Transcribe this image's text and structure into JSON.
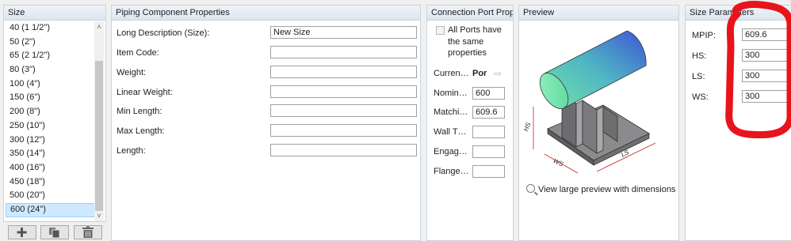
{
  "size_panel": {
    "title": "Size",
    "items": [
      "40 (1 1/2\")",
      "50 (2\")",
      "65 (2 1/2\")",
      "80 (3\")",
      "100 (4\")",
      "150 (6\")",
      "200 (8\")",
      "250 (10\")",
      "300 (12\")",
      "350 (14\")",
      "400 (16\")",
      "450 (18\")",
      "500 (20\")",
      "600 (24\")"
    ],
    "selected_index": 13,
    "buttons": [
      "add-icon",
      "copy-icon",
      "delete-icon"
    ]
  },
  "props_panel": {
    "title": "Piping Component Properties",
    "fields": [
      {
        "label": "Long Description (Size):",
        "value": "New Size"
      },
      {
        "label": "Item Code:",
        "value": ""
      },
      {
        "label": "Weight:",
        "value": ""
      },
      {
        "label": "Linear Weight:",
        "value": ""
      },
      {
        "label": "Min Length:",
        "value": ""
      },
      {
        "label": "Max Length:",
        "value": ""
      },
      {
        "label": "Length:",
        "value": ""
      }
    ]
  },
  "conn_panel": {
    "title": "Connection Port Prop",
    "checkbox_label": "All Ports have the same properties",
    "checkbox_checked": false,
    "current_label": "Curren…",
    "current_value": "Por",
    "fields": [
      {
        "label": "Nomin…",
        "value": "600"
      },
      {
        "label": "Matchi…",
        "value": "609.6"
      },
      {
        "label": "Wall T…",
        "value": ""
      },
      {
        "label": "Engag…",
        "value": ""
      },
      {
        "label": "Flange…",
        "value": ""
      }
    ]
  },
  "preview_panel": {
    "title": "Preview",
    "dim_labels": {
      "hs": "HS",
      "ws": "WS",
      "ls": "LS"
    },
    "link_text": "View large preview with dimensions"
  },
  "params_panel": {
    "title": "Size Parameters",
    "fields": [
      {
        "label": "MPIP:",
        "value": "609.6"
      },
      {
        "label": "HS:",
        "value": "300"
      },
      {
        "label": "LS:",
        "value": "300"
      },
      {
        "label": "WS:",
        "value": "300"
      }
    ]
  },
  "colors": {
    "annotation": "#e8141c",
    "selection": "#cde8ff",
    "header": "#dde6f0"
  }
}
